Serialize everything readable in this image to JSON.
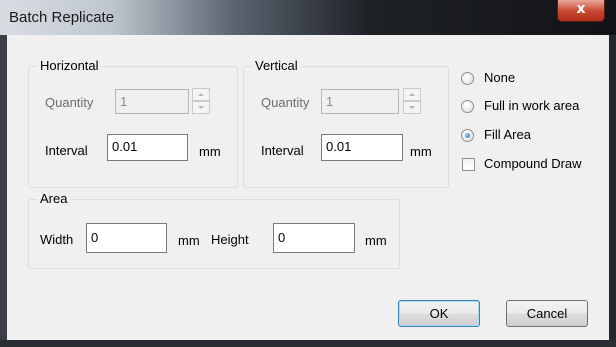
{
  "window": {
    "title": "Batch Replicate",
    "close_label": "x"
  },
  "horizontal": {
    "group_label": "Horizontal",
    "quantity_label": "Quantity",
    "quantity_value": "1",
    "interval_label": "Interval",
    "interval_value": "0.01",
    "interval_unit": "mm"
  },
  "vertical": {
    "group_label": "Vertical",
    "quantity_label": "Quantity",
    "quantity_value": "1",
    "interval_label": "Interval",
    "interval_value": "0.01",
    "interval_unit": "mm"
  },
  "mode": {
    "options": [
      "None",
      "Full in work area",
      "Fill Area"
    ],
    "selected": "Fill Area"
  },
  "compound_draw": {
    "label": "Compound Draw",
    "checked": false
  },
  "area": {
    "group_label": "Area",
    "width_label": "Width",
    "width_value": "0",
    "width_unit": "mm",
    "height_label": "Height",
    "height_value": "0",
    "height_unit": "mm"
  },
  "buttons": {
    "ok": "OK",
    "cancel": "Cancel"
  }
}
